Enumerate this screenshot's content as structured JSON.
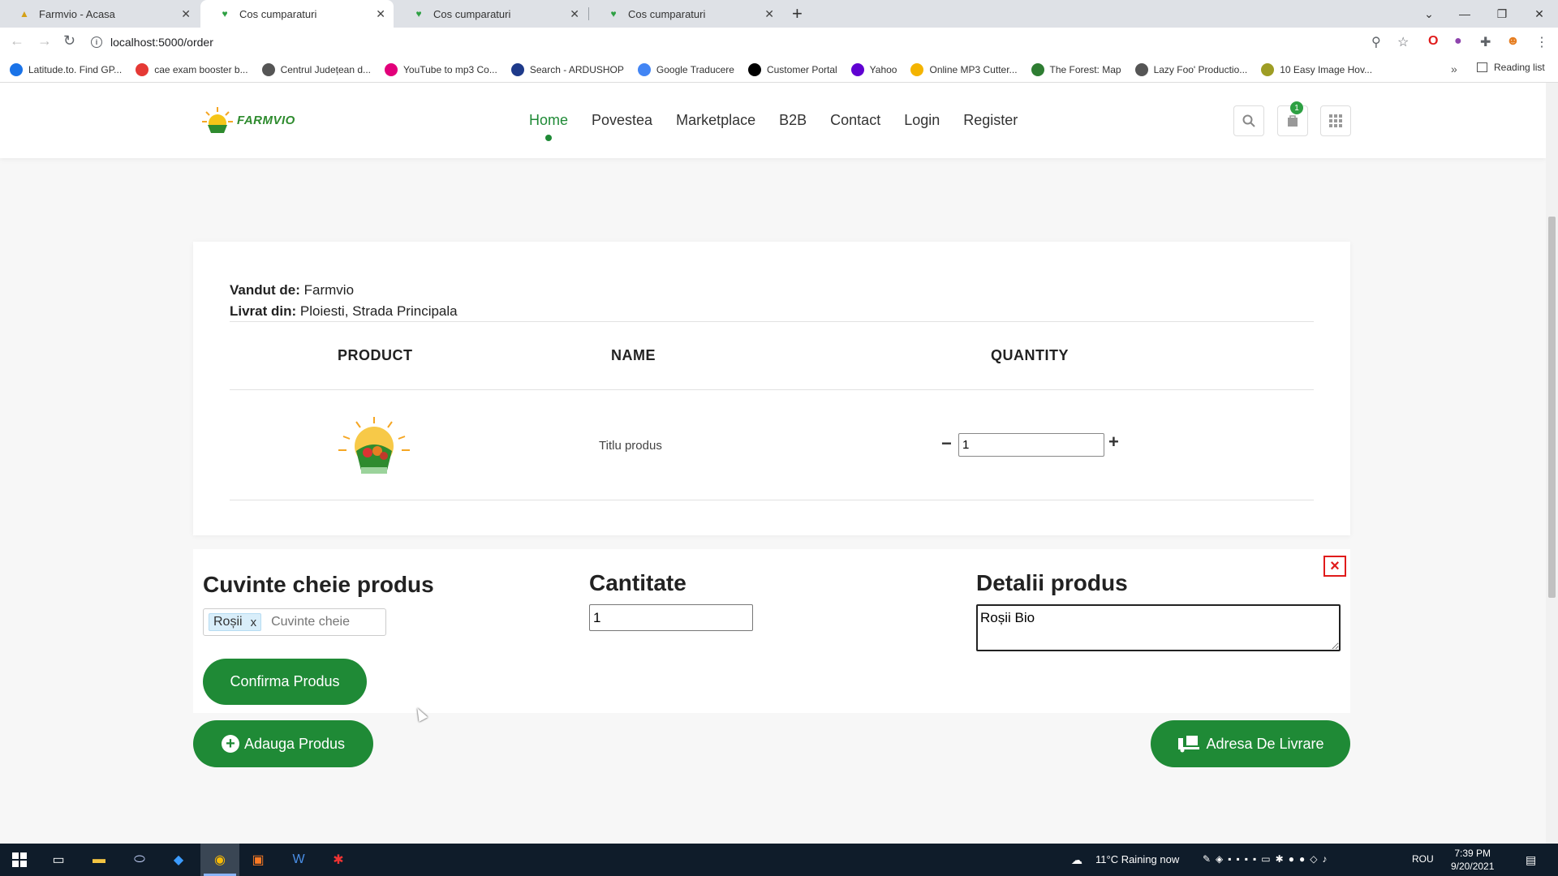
{
  "browser": {
    "tabs": [
      {
        "title": "Farmvio - Acasa",
        "active": false
      },
      {
        "title": "Cos cumparaturi",
        "active": true
      },
      {
        "title": "Cos cumparaturi",
        "active": false
      },
      {
        "title": "Cos cumparaturi",
        "active": false
      }
    ],
    "url": "localhost:5000/order",
    "bookmarks": [
      {
        "label": "Latitude.to. Find GP...",
        "color": "#1a73e8"
      },
      {
        "label": "cae exam booster b...",
        "color": "#e53935"
      },
      {
        "label": "Centrul Județean d...",
        "color": "#555555"
      },
      {
        "label": "YouTube to mp3 Co...",
        "color": "#e2007a"
      },
      {
        "label": "Search - ARDUSHOP",
        "color": "#1e3a8a"
      },
      {
        "label": "Google Traducere",
        "color": "#4285f4"
      },
      {
        "label": "Customer Portal",
        "color": "#000000"
      },
      {
        "label": "Yahoo",
        "color": "#6001d2"
      },
      {
        "label": "Online MP3 Cutter...",
        "color": "#f4b400"
      },
      {
        "label": "The Forest: Map",
        "color": "#2e7d32"
      },
      {
        "label": "Lazy Foo' Productio...",
        "color": "#555555"
      },
      {
        "label": "10 Easy Image Hov...",
        "color": "#9e9d24"
      }
    ],
    "reading_list": "Reading list"
  },
  "site": {
    "logo_text": "FARMVIO",
    "nav": [
      {
        "label": "Home",
        "active": true
      },
      {
        "label": "Povestea",
        "active": false
      },
      {
        "label": "Marketplace",
        "active": false
      },
      {
        "label": "B2B",
        "active": false
      },
      {
        "label": "Contact",
        "active": false
      },
      {
        "label": "Login",
        "active": false
      },
      {
        "label": "Register",
        "active": false
      }
    ],
    "cart_count": "1",
    "accent_color": "#1f8a36"
  },
  "order": {
    "sold_by_label": "Vandut de:",
    "sold_by_value": "Farmvio",
    "delivered_from_label": "Livrat din:",
    "delivered_from_value": "Ploiesti, Strada Principala",
    "columns": {
      "product": "PRODUCT",
      "name": "NAME",
      "quantity": "QUANTITY"
    },
    "item": {
      "name": "Titlu produs",
      "quantity": "1"
    }
  },
  "form": {
    "keywords_title": "Cuvinte cheie produs",
    "keyword_tag": "Roșii",
    "keyword_tag_remove": "x",
    "keywords_placeholder": "Cuvinte cheie",
    "quantity_title": "Cantitate",
    "quantity_value": "1",
    "details_title": "Detalii produs",
    "details_value": "Roșii Bio",
    "confirm_button": "Confirma Produs",
    "close_symbol": "×"
  },
  "actions": {
    "add_product": "Adauga Produs",
    "delivery_address": "Adresa De Livrare"
  },
  "taskbar": {
    "weather": "11°C  Raining now",
    "language": "ROU",
    "time": "7:39 PM",
    "date": "9/20/2021"
  }
}
